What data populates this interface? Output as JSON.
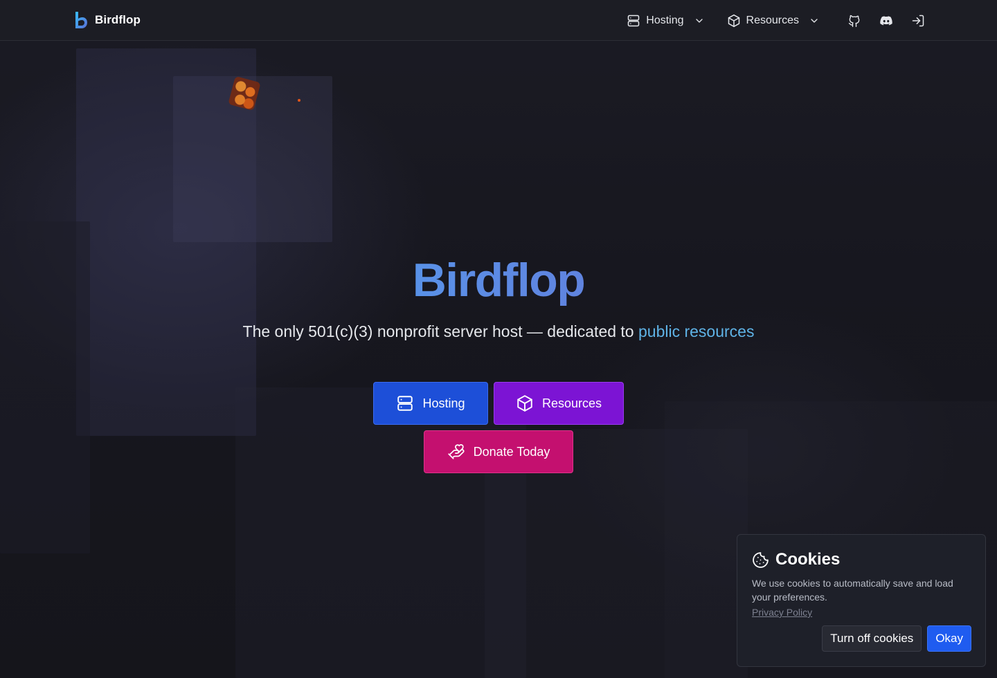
{
  "nav": {
    "brand": "Birdflop",
    "hosting_label": "Hosting",
    "resources_label": "Resources"
  },
  "hero": {
    "title": "Birdflop",
    "subtitle_main": "The only 501(c)(3) nonprofit server host — dedicated to ",
    "subtitle_link": "public resources",
    "buttons": {
      "hosting": "Hosting",
      "resources": "Resources",
      "donate": "Donate Today"
    }
  },
  "cookies": {
    "title": "Cookies",
    "text": "We use cookies to automatically save and load your preferences.",
    "privacy_link": "Privacy Policy",
    "turn_off": "Turn off cookies",
    "okay": "Okay"
  },
  "colors": {
    "hosting_button": "#1d4fd8",
    "resources_button": "#7c14d4",
    "donate_button": "#c4106f",
    "okay_button": "#1f5cf0",
    "link": "#5fb3e6"
  },
  "icons": {
    "hosting": "server-icon",
    "resources": "cube-icon",
    "github": "github-icon",
    "discord": "discord-icon",
    "login": "login-icon",
    "donate": "hand-heart-icon",
    "cookie": "cookie-icon"
  }
}
